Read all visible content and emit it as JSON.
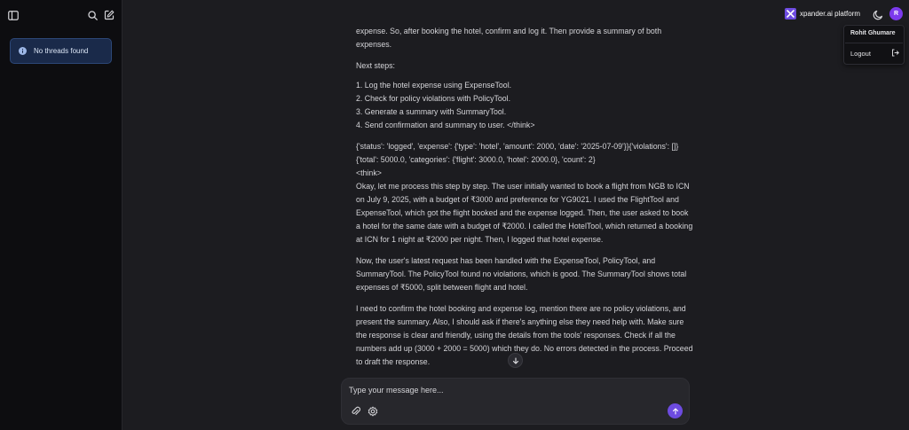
{
  "sidebar": {
    "toggle_icon": "sidebar-toggle-icon",
    "search_icon": "search-icon",
    "new_thread_icon": "edit-icon",
    "notice": "No threads found"
  },
  "header": {
    "brand": "xpander.ai platform",
    "theme_icon": "moon-icon",
    "avatar_initial": "R"
  },
  "user_menu": {
    "name": "Rohit Ghumare",
    "logout": "Logout"
  },
  "conversation": {
    "p1": "expense. So, after booking the hotel, confirm and log it. Then provide a summary of both expenses.",
    "p2": "Next steps:",
    "steps": [
      "1. Log the hotel expense using ExpenseTool.",
      "2. Check for policy violations with PolicyTool.",
      "3. Generate a summary with SummaryTool.",
      "4. Send confirmation and summary to user. </think>"
    ],
    "p3": "{'status': 'logged', 'expense': {'type': 'hotel', 'amount': 2000, 'date': '2025-07-09'}}{'violations': []}{'total': 5000.0, 'categories': {'flight': 3000.0, 'hotel': 2000.0}, 'count': 2}",
    "p4": "<think>",
    "p5": "Okay, let me process this step by step. The user initially wanted to book a flight from NGB to ICN on July 9, 2025, with a budget of ₹3000 and preference for YG9021. I used the FlightTool and ExpenseTool, which got the flight booked and the expense logged. Then, the user asked to book a hotel for the same date with a budget of ₹2000. I called the HotelTool, which returned a booking at ICN for 1 night at ₹2000 per night. Then, I logged that hotel expense.",
    "p6": "Now, the user's latest request has been handled with the ExpenseTool, PolicyTool, and SummaryTool. The PolicyTool found no violations, which is good. The SummaryTool shows total expenses of ₹5000, split between flight and hotel.",
    "p7": "I need to confirm the hotel booking and expense log, mention there are no policy violations, and present the summary. Also, I should ask if there's anything else they need help with. Make sure the response is clear and friendly, using the details from the tools' responses. Check if all the numbers add up (3000 + 2000 = 5000) which they do. No errors detected in the process. Proceed to draft the response."
  },
  "composer": {
    "placeholder": "Type your message here...",
    "attach_icon": "paperclip-icon",
    "settings_icon": "gear-icon",
    "send_icon": "arrow-up-icon"
  },
  "colors": {
    "accent": "#6d4be0",
    "avatar": "#7c3aed",
    "background": "#1c1c20",
    "sidebar": "#0d0d10",
    "notice_bg": "#1a2a4a"
  }
}
